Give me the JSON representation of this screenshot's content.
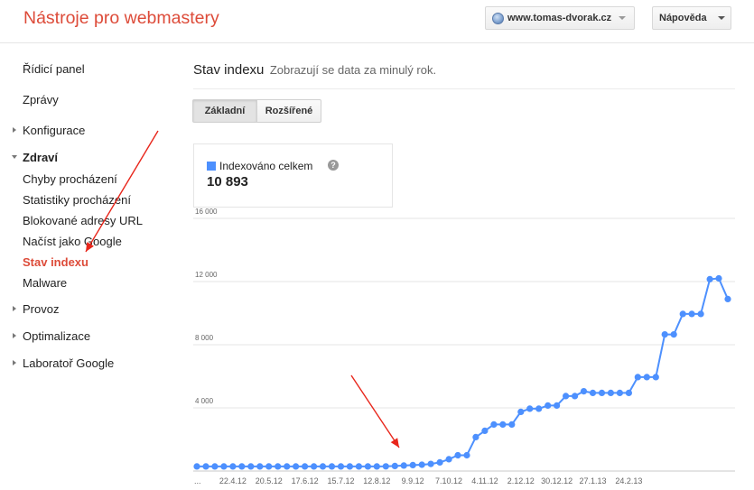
{
  "header": {
    "app_title": "Nástroje pro webmastery",
    "site_selector": "www.tomas-dvorak.cz",
    "help_label": "Nápověda"
  },
  "sidebar": {
    "items": [
      {
        "label": "Řídicí panel",
        "state": "normal"
      },
      {
        "label": "Zprávy",
        "state": "normal"
      },
      {
        "label": "Konfigurace",
        "state": "collapsed"
      },
      {
        "label": "Zdraví",
        "state": "expanded"
      },
      {
        "label": "Chyby procházení",
        "state": "child"
      },
      {
        "label": "Statistiky procházení",
        "state": "child"
      },
      {
        "label": "Blokované adresy URL",
        "state": "child"
      },
      {
        "label": "Načíst jako Google",
        "state": "child"
      },
      {
        "label": "Stav indexu",
        "state": "active"
      },
      {
        "label": "Malware",
        "state": "child"
      },
      {
        "label": "Provoz",
        "state": "collapsed"
      },
      {
        "label": "Optimalizace",
        "state": "collapsed"
      },
      {
        "label": "Laboratoř Google",
        "state": "collapsed"
      }
    ]
  },
  "main": {
    "title": "Stav indexu",
    "subtitle": "Zobrazují se data za minulý rok.",
    "tabs": [
      {
        "label": "Základní",
        "selected": true
      },
      {
        "label": "Rozšířené",
        "selected": false
      }
    ],
    "stat": {
      "label": "Indexováno celkem",
      "value": "10 893",
      "help_icon": "question-icon",
      "color": "#4d90fe"
    }
  },
  "annotations": [
    {
      "type": "arrow",
      "color": "#e8261b",
      "target": "sidebar-item-stav-indexu"
    },
    {
      "type": "arrow",
      "color": "#e8261b",
      "target": "chart-rise-start"
    }
  ],
  "chart_data": {
    "type": "line",
    "series": [
      {
        "name": "Indexováno celkem",
        "color": "#4d90fe",
        "values": [
          290,
          290,
          290,
          290,
          290,
          290,
          290,
          290,
          290,
          290,
          290,
          290,
          290,
          290,
          290,
          290,
          290,
          290,
          290,
          290,
          290,
          300,
          320,
          350,
          380,
          400,
          450,
          550,
          750,
          1000,
          1000,
          2150,
          2550,
          2950,
          2950,
          2950,
          3750,
          3950,
          3950,
          4150,
          4150,
          4750,
          4750,
          5050,
          4950,
          4950,
          4950,
          4950,
          4950,
          5950,
          5950,
          5950,
          8650,
          8650,
          9950,
          9950,
          9950,
          12150,
          12200,
          10893
        ]
      }
    ],
    "x_tick_labels": [
      "...",
      "22.4.12",
      "20.5.12",
      "17.6.12",
      "15.7.12",
      "12.8.12",
      "9.9.12",
      "7.10.12",
      "4.11.12",
      "2.12.12",
      "30.12.12",
      "27.1.13",
      "24.2.13"
    ],
    "y_ticks": [
      "4 000",
      "8 000",
      "12 000",
      "16 000"
    ],
    "ylim": [
      0,
      16000
    ],
    "grid": true
  }
}
